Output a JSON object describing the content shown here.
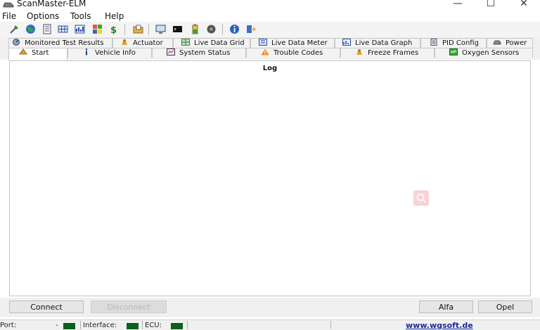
{
  "window": {
    "title": "ScanMaster-ELM",
    "minimize_glyph": "—",
    "maximize_glyph": "☐",
    "close_glyph": "✕"
  },
  "menu": [
    "File",
    "Options",
    "Tools",
    "Help"
  ],
  "toolbar_icons": [
    "connect-icon",
    "globe-icon",
    "document-icon",
    "grid-icon",
    "chart-icon",
    "palette-icon",
    "dollar-icon",
    "folder-icon",
    "monitor-icon",
    "terminal-icon",
    "battery-icon",
    "disc-icon",
    "info-icon",
    "exit-icon"
  ],
  "tabs_row1": [
    "Monitored Test Results",
    "Actuator",
    "Live Data Grid",
    "Live Data Meter",
    "Live Data Graph",
    "PID Config",
    "Power"
  ],
  "tabs_row2": [
    "Start",
    "Vehicle Info",
    "System Status",
    "Trouble Codes",
    "Freeze Frames",
    "Oxygen Sensors"
  ],
  "active_tab": "Start",
  "main": {
    "log_label": "Log"
  },
  "buttons": {
    "connect": "Connect",
    "disconnect": "Disconnect",
    "alfa": "Alfa",
    "opel": "Opel"
  },
  "status": {
    "port_label": "Port:",
    "port_value": "-",
    "interface_label": "Interface:",
    "ecu_label": "ECU:",
    "website": "www.wgsoft.de",
    "led_color": "#0a5f1a"
  }
}
